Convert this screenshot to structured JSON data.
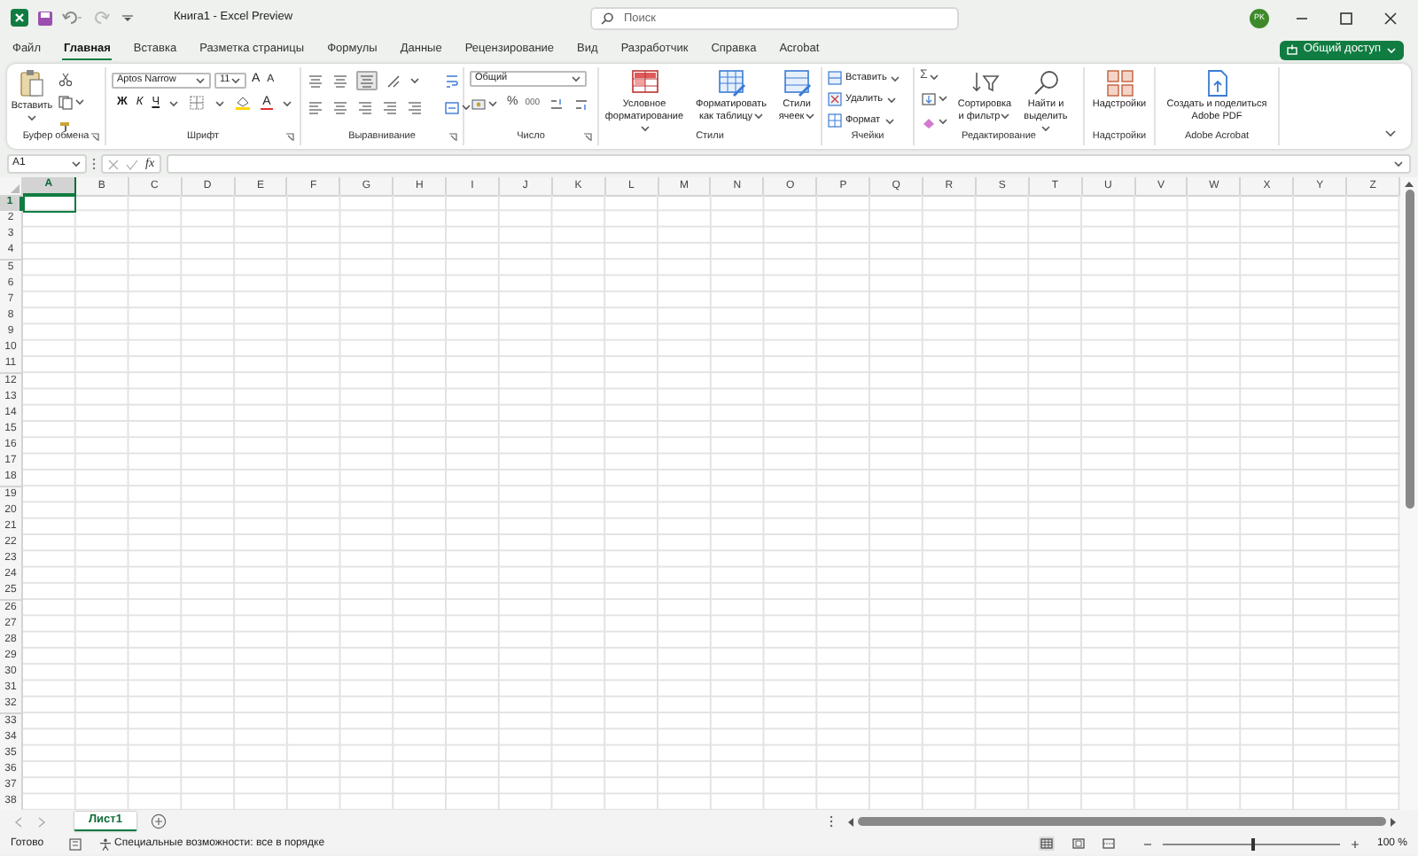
{
  "window": {
    "title": "Книга1 - Excel Preview",
    "search": {
      "placeholder": "Поиск"
    },
    "avatar": "PK"
  },
  "tabs": [
    {
      "label": "Файл",
      "selected": false
    },
    {
      "label": "Главная",
      "selected": true
    },
    {
      "label": "Вставка",
      "selected": false
    },
    {
      "label": "Разметка страницы",
      "selected": false
    },
    {
      "label": "Формулы",
      "selected": false
    },
    {
      "label": "Данные",
      "selected": false
    },
    {
      "label": "Рецензирование",
      "selected": false
    },
    {
      "label": "Вид",
      "selected": false
    },
    {
      "label": "Разработчик",
      "selected": false
    },
    {
      "label": "Справка",
      "selected": false
    },
    {
      "label": "Acrobat",
      "selected": false
    }
  ],
  "share_button": "Общий доступ",
  "ribbon": {
    "groups": [
      {
        "kind": "clipboard",
        "label": "Буфер обмена",
        "launcher": true,
        "paste": "Вставить"
      },
      {
        "kind": "font",
        "label": "Шрифт",
        "launcher": true,
        "font": "Aptos Narrow",
        "size": "11",
        "grow": "A",
        "shrink": "A",
        "style_buttons": [
          "Ж",
          "К",
          "Ч"
        ],
        "color_button": "A"
      },
      {
        "kind": "alignment",
        "label": "Выравнивание",
        "launcher": true
      },
      {
        "kind": "number",
        "label": "Число",
        "launcher": true,
        "format": "Общий",
        "percent": "%",
        "thousands": "000"
      },
      {
        "kind": "styles",
        "label": "Стили",
        "buttons": [
          "Условное форматирование",
          "Форматировать как таблицу",
          "Стили ячеек"
        ]
      },
      {
        "kind": "cells",
        "label": "Ячейки",
        "buttons": [
          "Вставить",
          "Удалить",
          "Формат"
        ]
      },
      {
        "kind": "editing",
        "label": "Редактирование",
        "sum": "Σ",
        "buttons": [
          "Сортировка и фильтр",
          "Найти и выделить"
        ]
      },
      {
        "kind": "addins",
        "label": "Надстройки",
        "buttons": [
          "Надстройки"
        ]
      },
      {
        "kind": "acrobat",
        "label": "Adobe Acrobat",
        "buttons": [
          "Создать и поделиться Adobe PDF"
        ]
      }
    ]
  },
  "formula_bar": {
    "name_box": "A1",
    "fx": "fx"
  },
  "grid": {
    "columns": [
      {
        "label": "A",
        "selected": true
      },
      {
        "label": "B",
        "selected": false
      },
      {
        "label": "C",
        "selected": false
      },
      {
        "label": "D",
        "selected": false
      },
      {
        "label": "E",
        "selected": false
      },
      {
        "label": "F",
        "selected": false
      },
      {
        "label": "G",
        "selected": false
      },
      {
        "label": "H",
        "selected": false
      },
      {
        "label": "I",
        "selected": false
      },
      {
        "label": "J",
        "selected": false
      },
      {
        "label": "K",
        "selected": false
      },
      {
        "label": "L",
        "selected": false
      },
      {
        "label": "M",
        "selected": false
      },
      {
        "label": "N",
        "selected": false
      },
      {
        "label": "O",
        "selected": false
      },
      {
        "label": "P",
        "selected": false
      },
      {
        "label": "Q",
        "selected": false
      },
      {
        "label": "R",
        "selected": false
      },
      {
        "label": "S",
        "selected": false
      },
      {
        "label": "T",
        "selected": false
      },
      {
        "label": "U",
        "selected": false
      },
      {
        "label": "V",
        "selected": false
      },
      {
        "label": "W",
        "selected": false
      },
      {
        "label": "X",
        "selected": false
      },
      {
        "label": "Y",
        "selected": false
      },
      {
        "label": "Z",
        "selected": false
      }
    ],
    "rows": [
      {
        "label": "1",
        "selected": true
      },
      {
        "label": "2",
        "selected": false
      },
      {
        "label": "3",
        "selected": false
      },
      {
        "label": "4",
        "selected": false
      },
      {
        "label": "5",
        "selected": false
      },
      {
        "label": "6",
        "selected": false
      },
      {
        "label": "7",
        "selected": false
      },
      {
        "label": "8",
        "selected": false
      },
      {
        "label": "9",
        "selected": false
      },
      {
        "label": "10",
        "selected": false
      },
      {
        "label": "11",
        "selected": false
      },
      {
        "label": "12",
        "selected": false
      },
      {
        "label": "13",
        "selected": false
      },
      {
        "label": "14",
        "selected": false
      },
      {
        "label": "15",
        "selected": false
      },
      {
        "label": "16",
        "selected": false
      },
      {
        "label": "17",
        "selected": false
      },
      {
        "label": "18",
        "selected": false
      },
      {
        "label": "19",
        "selected": false
      },
      {
        "label": "20",
        "selected": false
      },
      {
        "label": "21",
        "selected": false
      },
      {
        "label": "22",
        "selected": false
      },
      {
        "label": "23",
        "selected": false
      },
      {
        "label": "24",
        "selected": false
      },
      {
        "label": "25",
        "selected": false
      },
      {
        "label": "26",
        "selected": false
      },
      {
        "label": "27",
        "selected": false
      },
      {
        "label": "28",
        "selected": false
      },
      {
        "label": "29",
        "selected": false
      },
      {
        "label": "30",
        "selected": false
      },
      {
        "label": "31",
        "selected": false
      },
      {
        "label": "32",
        "selected": false
      },
      {
        "label": "33",
        "selected": false
      },
      {
        "label": "34",
        "selected": false
      },
      {
        "label": "35",
        "selected": false
      },
      {
        "label": "36",
        "selected": false
      },
      {
        "label": "37",
        "selected": false
      },
      {
        "label": "38",
        "selected": false
      }
    ]
  },
  "sheet_tabs": [
    {
      "label": "Лист1",
      "selected": true
    }
  ],
  "status_bar": {
    "status": "Готово",
    "accessibility": "Специальные возможности: все в порядке",
    "zoom": {
      "level": 0.5,
      "reading": "100 %"
    }
  }
}
